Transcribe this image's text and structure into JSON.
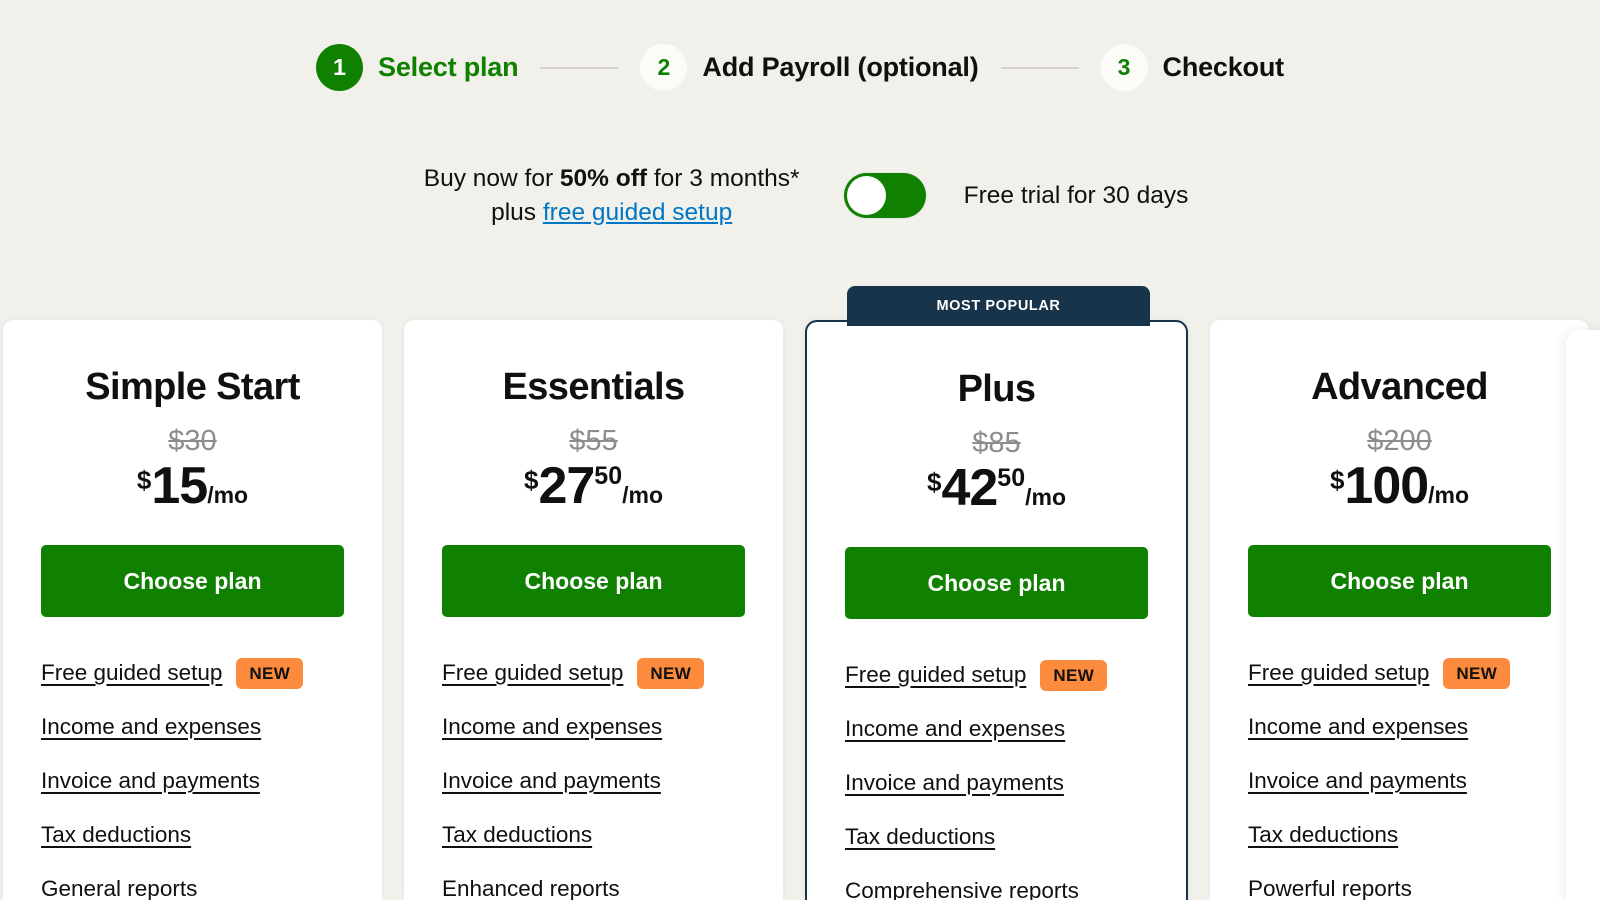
{
  "stepper": {
    "steps": [
      {
        "number": "1",
        "label": "Select plan",
        "state": "active"
      },
      {
        "number": "2",
        "label": "Add Payroll (optional)",
        "state": "inactive"
      },
      {
        "number": "3",
        "label": "Checkout",
        "state": "inactive"
      }
    ]
  },
  "promo": {
    "line1_prefix": "Buy now for ",
    "line1_bold": "50% off",
    "line1_suffix": " for 3 months*",
    "line2_prefix": "plus ",
    "line2_link": "free guided setup",
    "toggle_caption": "Free trial for 30 days",
    "toggle_state": "off"
  },
  "colors": {
    "brand_green": "#108000",
    "badge_navy": "#17344b",
    "badge_orange": "#fc8b3d",
    "link_blue": "#0077c5",
    "page_background": "#f1f0ea"
  },
  "cards": [
    {
      "name": "Simple Start",
      "price_old": "$30",
      "currency": "$",
      "price_int": "15",
      "price_cents": "",
      "price_per": "/mo",
      "cta": "Choose plan",
      "featured": false,
      "badge": "",
      "features": [
        {
          "label": "Free guided setup",
          "badge": "NEW"
        },
        {
          "label": "Income and expenses",
          "badge": ""
        },
        {
          "label": "Invoice and payments",
          "badge": ""
        },
        {
          "label": "Tax deductions",
          "badge": ""
        },
        {
          "label": "General reports",
          "badge": ""
        }
      ]
    },
    {
      "name": "Essentials",
      "price_old": "$55",
      "currency": "$",
      "price_int": "27",
      "price_cents": "50",
      "price_per": "/mo",
      "cta": "Choose plan",
      "featured": false,
      "badge": "",
      "features": [
        {
          "label": "Free guided setup",
          "badge": "NEW"
        },
        {
          "label": "Income and expenses",
          "badge": ""
        },
        {
          "label": "Invoice and payments",
          "badge": ""
        },
        {
          "label": "Tax deductions",
          "badge": ""
        },
        {
          "label": "Enhanced reports",
          "badge": ""
        }
      ]
    },
    {
      "name": "Plus",
      "price_old": "$85",
      "currency": "$",
      "price_int": "42",
      "price_cents": "50",
      "price_per": "/mo",
      "cta": "Choose plan",
      "featured": true,
      "badge": "MOST POPULAR",
      "features": [
        {
          "label": "Free guided setup",
          "badge": "NEW"
        },
        {
          "label": "Income and expenses",
          "badge": ""
        },
        {
          "label": "Invoice and payments",
          "badge": ""
        },
        {
          "label": "Tax deductions",
          "badge": ""
        },
        {
          "label": "Comprehensive reports",
          "badge": ""
        }
      ]
    },
    {
      "name": "Advanced",
      "price_old": "$200",
      "currency": "$",
      "price_int": "100",
      "price_cents": "",
      "price_per": "/mo",
      "cta": "Choose plan",
      "featured": false,
      "badge": "",
      "features": [
        {
          "label": "Free guided setup",
          "badge": "NEW"
        },
        {
          "label": "Income and expenses",
          "badge": ""
        },
        {
          "label": "Invoice and payments",
          "badge": ""
        },
        {
          "label": "Tax deductions",
          "badge": ""
        },
        {
          "label": "Powerful reports",
          "badge": ""
        }
      ]
    }
  ]
}
